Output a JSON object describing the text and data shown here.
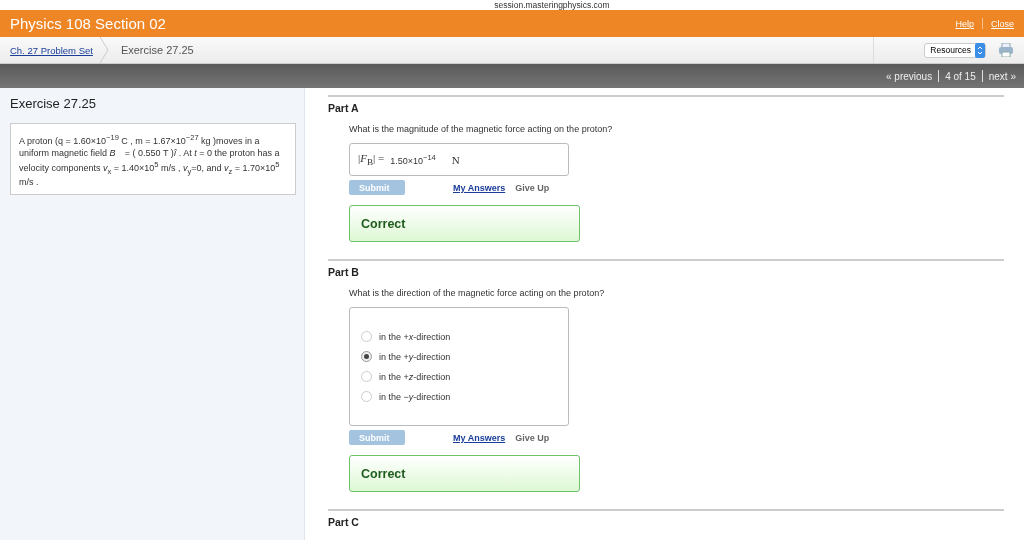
{
  "browser_bar": {
    "address": "session.masteringphysics.com"
  },
  "header": {
    "title": "Physics 108 Section 02",
    "links": [
      "Help",
      "Close"
    ]
  },
  "breadcrumb": {
    "link": "Ch. 27 Problem Set",
    "current": "Exercise 27.25",
    "resources": "Resources"
  },
  "pager": {
    "previous": "« previous",
    "position": "4 of 15",
    "next": "next »"
  },
  "problem": {
    "title": "Exercise 27.25",
    "text": "A proton (q = 1.60×10$^{−19}$ C , m = 1.67×10$^{−27}$ kg )moves in a uniform magnetic field *B⃗* = ( 0.550 T )*î* . At *t* = 0 the proton has a velocity components *v*$_{x}$ = 1.40×10$^{5}$ m/s , *v*$_{y}$=0, and *v*$_{z}$ = 1.70×10$^{5}$ m/s ."
  },
  "parts": [
    {
      "kind": "numeric",
      "title": "Part A",
      "question": "What is the magnitude of the magnetic force acting on the proton?",
      "answer": {
        "label": "|*F*$_{B}$| =",
        "value": "1.50×10$^{−14}$",
        "unit": "N"
      },
      "submit": "Submit",
      "my_answers": "My Answers",
      "give_up": "Give Up",
      "feedback": "Correct"
    },
    {
      "kind": "choice",
      "title": "Part B",
      "question": "What is the direction of the magnetic force acting on the proton?",
      "options": [
        {
          "label": "in the +*x*-direction",
          "selected": false
        },
        {
          "label": "in the +*y*-direction",
          "selected": true
        },
        {
          "label": "in the +*z*-direction",
          "selected": false
        },
        {
          "label": "in the −*y*-direction",
          "selected": false
        }
      ],
      "submit": "Submit",
      "my_answers": "My Answers",
      "give_up": "Give Up",
      "feedback": "Correct"
    },
    {
      "kind": "heading",
      "title": "Part C"
    }
  ]
}
